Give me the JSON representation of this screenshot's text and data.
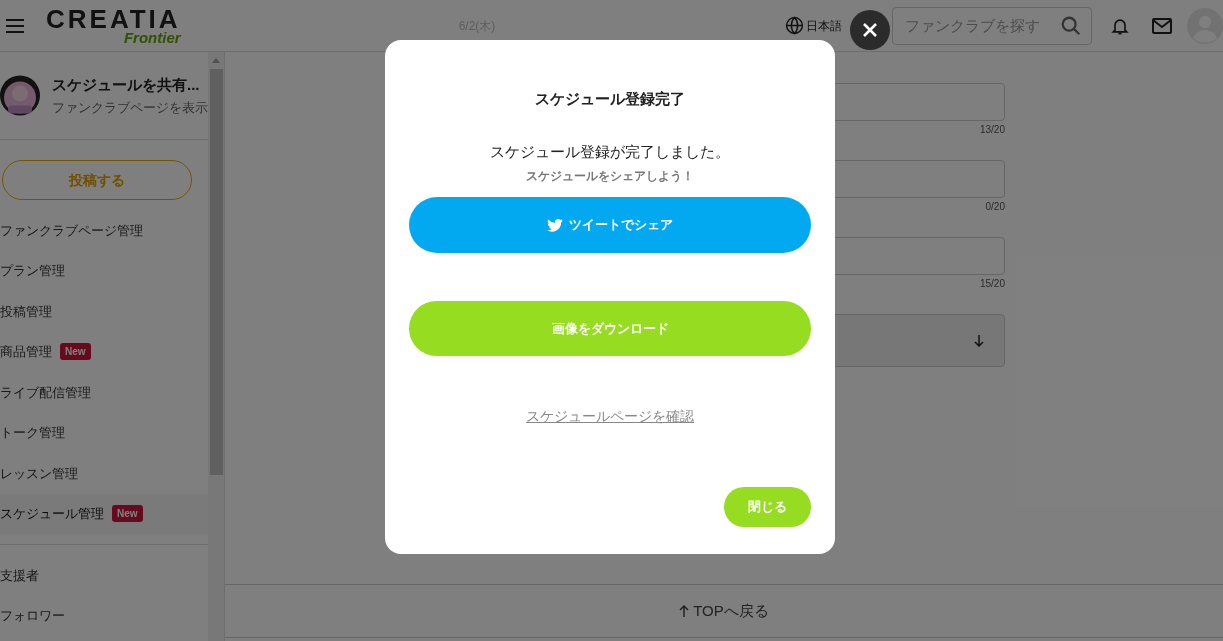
{
  "header": {
    "logo_main": "CREATIA",
    "logo_sub": "Frontier",
    "date": "6/2(木)",
    "language": "日本語",
    "search": {
      "placeholder": "ファンクラブを探す"
    }
  },
  "sidebar": {
    "profile": {
      "name": "スケジュールを共有...",
      "link": "ファンクラブページを表示"
    },
    "post_button": "投稿する",
    "items": [
      {
        "label": "ファンクラブページ管理",
        "selected": false
      },
      {
        "label": "プラン管理",
        "selected": false
      },
      {
        "label": "投稿管理",
        "selected": false
      },
      {
        "label": "商品管理",
        "badge": "New",
        "selected": false
      },
      {
        "label": "ライブ配信管理",
        "selected": false
      },
      {
        "label": "トーク管理",
        "selected": false
      },
      {
        "label": "レッスン管理",
        "selected": false
      },
      {
        "label": "スケジュール管理",
        "badge": "New",
        "selected": true
      }
    ],
    "secondary_items": [
      {
        "label": "支援者"
      },
      {
        "label": "フォロワー"
      }
    ]
  },
  "form": {
    "fields": [
      {
        "counter": "13/20"
      },
      {
        "counter": "0/20"
      },
      {
        "counter": "15/20"
      }
    ]
  },
  "footer": {
    "back_to_top": "TOPへ戻る"
  },
  "modal": {
    "title": "スケジュール登録完了",
    "message": "スケジュール登録が完了しました。",
    "sub_message": "スケジュールをシェアしよう！",
    "tweet_button": "ツイートでシェア",
    "download_button": "画像をダウンロード",
    "link": "スケジュールページを確認",
    "close_button": "閉じる"
  }
}
